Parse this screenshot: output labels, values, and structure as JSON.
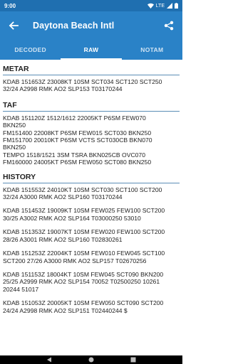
{
  "status_bar": {
    "time": "9:00",
    "network": "LTE"
  },
  "app_bar": {
    "title": "Daytona Beach Intl"
  },
  "tabs": [
    {
      "label": "DECODED"
    },
    {
      "label": "RAW"
    },
    {
      "label": "NOTAM"
    }
  ],
  "active_tab": "RAW",
  "metar": {
    "header": "METAR",
    "lines": [
      "KDAB 151653Z 23008KT 10SM SCT034 SCT120 SCT250",
      "32/24 A2998 RMK AO2 SLP153 T03170244"
    ]
  },
  "taf": {
    "header": "TAF",
    "lines": [
      "KDAB 151120Z 1512/1612 22005KT P6SM FEW070",
      "BKN250",
      "FM151400 22008KT P6SM FEW015 SCT030 BKN250",
      "FM151700 20010KT P6SM VCTS SCT030CB BKN070",
      "BKN250",
      "TEMPO 1518/1521 3SM TSRA BKN025CB OVC070",
      "FM160000 24005KT P6SM FEW050 SCT080 BKN250"
    ]
  },
  "history": {
    "header": "HISTORY",
    "items": [
      {
        "lines": [
          "KDAB 151553Z 24010KT 10SM SCT030 SCT100 SCT200",
          "32/24 A3000 RMK AO2 SLP160 T03170244"
        ]
      },
      {
        "lines": [
          "KDAB 151453Z 19009KT 10SM FEW025 FEW100 SCT200",
          "30/25 A3002 RMK AO2 SLP164 T03000250 53010"
        ]
      },
      {
        "lines": [
          "KDAB 151353Z 19007KT 10SM FEW020 FEW100 SCT200",
          "28/26 A3001 RMK AO2 SLP160 T02830261"
        ]
      },
      {
        "lines": [
          "KDAB 151253Z 22004KT 10SM FEW010 FEW045 SCT100",
          "SCT200 27/26 A3000 RMK AO2 SLP157 T02670256"
        ]
      },
      {
        "lines": [
          "KDAB 151153Z 18004KT 10SM FEW045 SCT090 BKN200",
          "25/25 A2999 RMK AO2 SLP154 70052 T02500250 10261",
          "20244 51017"
        ]
      },
      {
        "lines": [
          "KDAB 151053Z 20005KT 10SM FEW050 SCT090 SCT200",
          "24/24 A2998 RMK AO2 SLP151 T02440244 $"
        ]
      }
    ]
  },
  "colors": {
    "status_bar": "#1f6fb0",
    "app_bar": "#2a82c7",
    "divider": "#5b8db6"
  }
}
